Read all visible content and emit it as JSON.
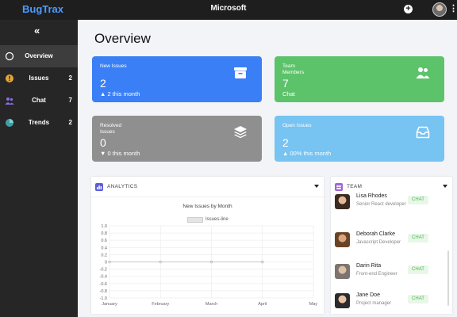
{
  "brand": "BugTrax",
  "org": "Microsoft",
  "header": {
    "add_label": "+",
    "menu_label": "⋮"
  },
  "sidebar": {
    "collapse_label": "«",
    "items": [
      {
        "label": "Overview",
        "count": ""
      },
      {
        "label": "Issues",
        "count": "2"
      },
      {
        "label": "Chat",
        "count": "7"
      },
      {
        "label": "Trends",
        "count": "2"
      }
    ]
  },
  "page_title": "Overview",
  "cards": [
    {
      "label": "New Issues",
      "value": "2",
      "foot": "▲ 2 this month",
      "color": "#3a7ff5"
    },
    {
      "label": "Team Members",
      "value": "7",
      "foot": "Chat",
      "color": "#5cc36a"
    },
    {
      "label": "Resolved Issues",
      "value": "0",
      "foot": "▼ 0 this month",
      "color": "#8f8f8f"
    },
    {
      "label": "Open Issues",
      "value": "2",
      "foot": "▲ 00% this month",
      "color": "#77c3f2"
    }
  ],
  "analytics": {
    "title": "ANALYTICS",
    "badge_color": "#5a5fd6"
  },
  "team": {
    "title": "TEAM",
    "badge_color": "#a364d8",
    "chat_label": "CHAT",
    "members": [
      {
        "name": "Lisa Rhodes",
        "role": "Senior React developer"
      },
      {
        "name": "Deborah Clarke",
        "role": "Javascript Developer"
      },
      {
        "name": "Darin Rita",
        "role": "Front-end Engineer"
      },
      {
        "name": "Jane Doe",
        "role": "Project manager"
      }
    ]
  },
  "chart_data": {
    "type": "line",
    "title": "New Issues by Month",
    "categories": [
      "January",
      "February",
      "March",
      "April",
      "May"
    ],
    "series": [
      {
        "name": "Issues-line",
        "values": [
          0,
          0,
          0,
          0
        ]
      }
    ],
    "ylim": [
      -1.0,
      1.0
    ],
    "yticks": [
      "1.0",
      "0.8",
      "0.6",
      "0.4",
      "0.2",
      "0",
      "-0.2",
      "-0.4",
      "-0.6",
      "-0.8",
      "-1.0"
    ],
    "grid": true,
    "legend": "top"
  }
}
